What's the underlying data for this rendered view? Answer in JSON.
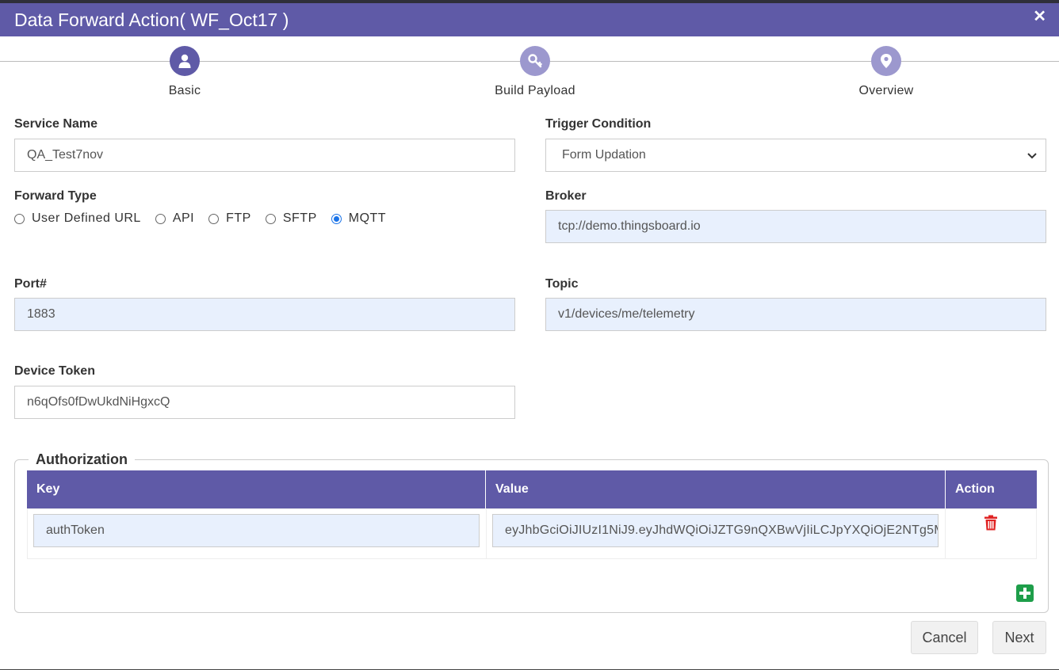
{
  "header": {
    "title": "Data Forward Action( WF_Oct17 )",
    "close_icon": "close-icon"
  },
  "steps": [
    {
      "label": "Basic",
      "icon": "user-icon",
      "color": "#5f5aa7"
    },
    {
      "label": "Build Payload",
      "icon": "key-icon",
      "color": "#9c98ce"
    },
    {
      "label": "Overview",
      "icon": "map-pin-icon",
      "color": "#9c98ce"
    }
  ],
  "form": {
    "service_name": {
      "label": "Service Name",
      "value": "QA_Test7nov"
    },
    "trigger_condition": {
      "label": "Trigger Condition",
      "value": "Form Updation"
    },
    "forward_type": {
      "label": "Forward Type",
      "options": [
        "User Defined URL",
        "API",
        "FTP",
        "SFTP",
        "MQTT"
      ],
      "selected": "MQTT"
    },
    "broker": {
      "label": "Broker",
      "value": "tcp://demo.thingsboard.io"
    },
    "port": {
      "label": "Port#",
      "value": "1883"
    },
    "topic": {
      "label": "Topic",
      "value": "v1/devices/me/telemetry"
    },
    "device_token": {
      "label": "Device Token",
      "value": "n6qOfs0fDwUkdNiHgxcQ"
    }
  },
  "authorization": {
    "legend": "Authorization",
    "columns": {
      "key": "Key",
      "value": "Value",
      "action": "Action"
    },
    "rows": [
      {
        "key": "authToken",
        "value": "eyJhbGciOiJIUzI1NiJ9.eyJhdWQiOiJZTG9nQXBwVjIiLCJpYXQiOjE2NTg5M"
      }
    ]
  },
  "buttons": {
    "cancel": "Cancel",
    "next": "Next"
  },
  "colors": {
    "accent": "#5f5aa7",
    "step_inactive": "#9c98ce",
    "delete": "#e02424",
    "add": "#1e9e4a",
    "filled_input": "#e8f0fd"
  }
}
